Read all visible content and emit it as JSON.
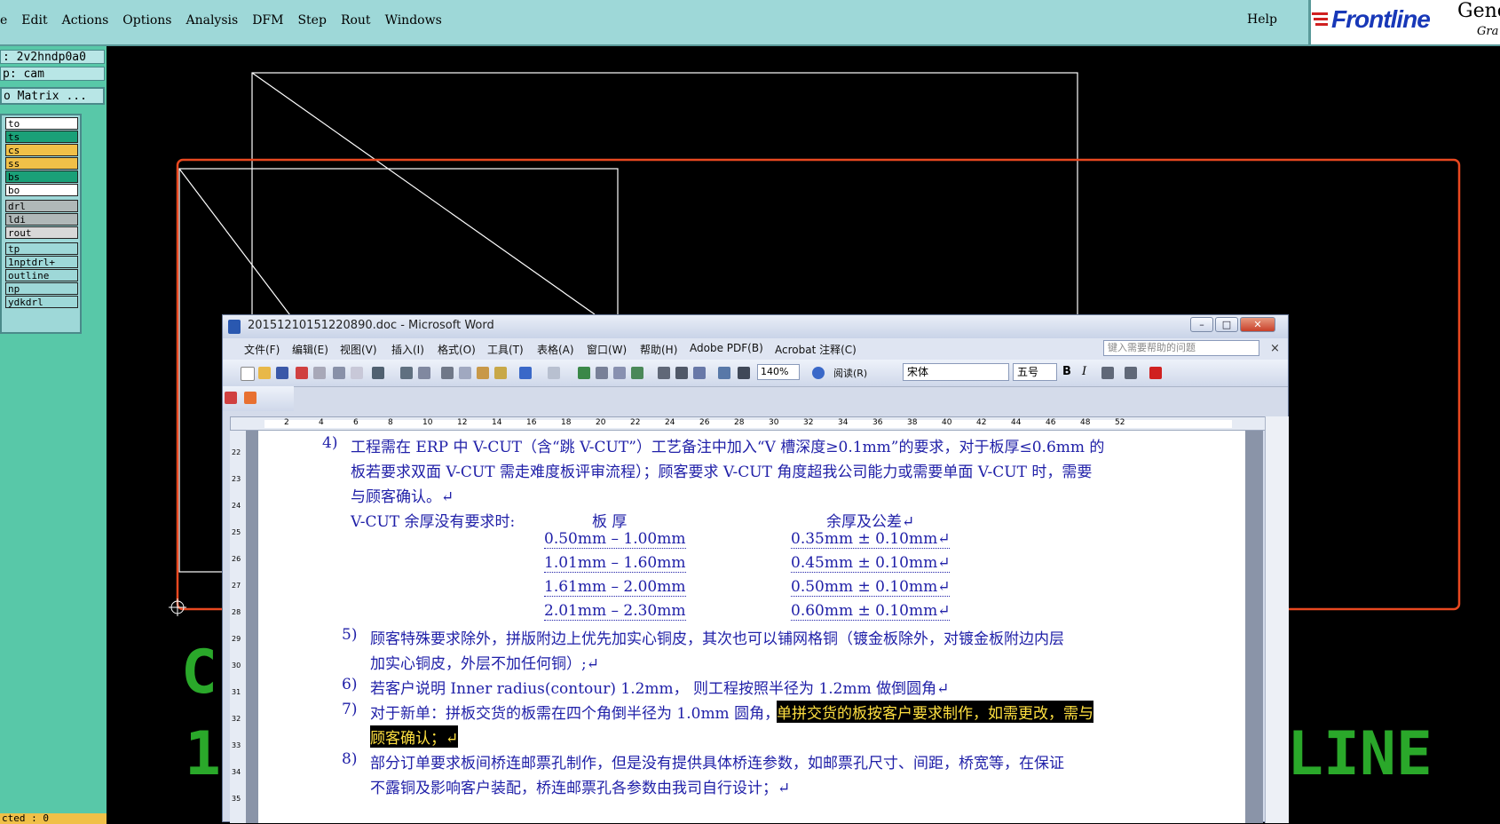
{
  "genesis": {
    "menus": [
      {
        "label": "e"
      },
      {
        "label": "Edit"
      },
      {
        "label": "Actions"
      },
      {
        "label": "Options"
      },
      {
        "label": "Analysis"
      },
      {
        "label": "DFM"
      },
      {
        "label": "Step"
      },
      {
        "label": "Rout"
      },
      {
        "label": "Windows"
      }
    ],
    "help_label": "Help",
    "logo_text": "Frontline",
    "logo_gene": "Gene",
    "logo_gra": "Gra",
    "job_field": ": 2v2hndp0a0",
    "step_field": "p: cam",
    "matrix_button": "o Matrix ...",
    "layers": [
      {
        "name": "to",
        "color": "#ffffff"
      },
      {
        "name": "ts",
        "color": "#1aa078"
      },
      {
        "name": "cs",
        "color": "#f0c048"
      },
      {
        "name": "ss",
        "color": "#f0c048"
      },
      {
        "name": "bs",
        "color": "#1aa078"
      },
      {
        "name": "bo",
        "color": "#ffffff"
      },
      {
        "name": "drl",
        "color": "#b0b8b8"
      },
      {
        "name": "ldi",
        "color": "#b0b8b8"
      },
      {
        "name": "rout",
        "color": "#d8d8d8"
      },
      {
        "name": "tp",
        "color": "#9ed8d8"
      },
      {
        "name": "1nptdrl+",
        "color": "#9ed8d8"
      },
      {
        "name": "outline",
        "color": "#9ed8d8"
      },
      {
        "name": "np",
        "color": "#9ed8d8"
      },
      {
        "name": "ydkdrl",
        "color": "#9ed8d8"
      }
    ],
    "bottom_field": "cted : 0",
    "canvas_text_1": "C",
    "canvas_text_2": "1",
    "canvas_text_3": "LINE"
  },
  "word": {
    "title": "20151210151220890.doc - Microsoft Word",
    "minimize": "–",
    "maximize": "□",
    "close": "✕",
    "menus": [
      {
        "label": "文件(F)"
      },
      {
        "label": "编辑(E)"
      },
      {
        "label": "视图(V)"
      },
      {
        "label": "插入(I)"
      },
      {
        "label": "格式(O)"
      },
      {
        "label": "工具(T)"
      },
      {
        "label": "表格(A)"
      },
      {
        "label": "窗口(W)"
      },
      {
        "label": "帮助(H)"
      },
      {
        "label": "Adobe PDF(B)"
      },
      {
        "label": "Acrobat 注释(C)"
      }
    ],
    "help_placeholder": "键入需要帮助的问题",
    "menu_close": "×",
    "zoom": "140%",
    "read_label": "阅读(R)",
    "font_name": "宋体",
    "font_size": "五号",
    "bold": "B",
    "italic": "I",
    "ruler_numbers": [
      "2",
      "4",
      "6",
      "8",
      "10",
      "12",
      "14",
      "16",
      "18",
      "20",
      "22",
      "24",
      "26",
      "28",
      "30",
      "32",
      "34",
      "36",
      "38",
      "40",
      "42",
      "44",
      "46",
      "48",
      "52"
    ],
    "vruler_numbers": [
      "22",
      "23",
      "24",
      "25",
      "26",
      "27",
      "28",
      "29",
      "30",
      "31",
      "32",
      "33",
      "34",
      "35"
    ],
    "doc": {
      "item4_num": "4)",
      "item4_line1": "工程需在 ERP 中 V-CUT（含“跳 V-CUT”）工艺备注中加入“V 槽深度≥0.1mm”的要求，对于板厚≤0.6mm 的",
      "item4_line2": "板若要求双面 V-CUT 需走难度板评审流程）；顾客要求 V-CUT 角度超我公司能力或需要单面 V-CUT 时，需要",
      "item4_line3": "与顾客确认。↵",
      "vcut_label": "V-CUT 余厚没有要求时:",
      "col_thickness": "板   厚",
      "col_remain": "余厚及公差↵",
      "table_rows": [
        {
          "thickness": "0.50mm – 1.00mm",
          "remain": "0.35mm ± 0.10mm↵"
        },
        {
          "thickness": "1.01mm – 1.60mm",
          "remain": "0.45mm ± 0.10mm↵"
        },
        {
          "thickness": "1.61mm – 2.00mm",
          "remain": "0.50mm ± 0.10mm↵"
        },
        {
          "thickness": "2.01mm – 2.30mm",
          "remain": "0.60mm ± 0.10mm↵"
        }
      ],
      "item5_num": "5)",
      "item5_line1": "顾客特殊要求除外，拼版附边上优先加实心铜皮，其次也可以铺网格铜（镀金板除外，对镀金板附边内层",
      "item5_line2": "加实心铜皮，外层不加任何铜）;↵",
      "item6_num": "6)",
      "item6_line1": "若客户说明 Inner radius(contour) 1.2mm， 则工程按照半径为 1.2mm 做倒圆角↵",
      "item7_num": "7)",
      "item7_line1a": "对于新单：拼板交货的板需在四个角倒半径为 1.0mm 圆角，",
      "item7_line1b": "单拼交货的板按客户要求制作，如需更改，需与",
      "item7_line2": "顾客确认；↵",
      "item8_num": "8)",
      "item8_line1": "部分订单要求板间桥连邮票孔制作，但是没有提供具体桥连参数，如邮票孔尺寸、间距，桥宽等，在保证",
      "item8_line2": "不露铜及影响客户装配，桥连邮票孔各参数由我司自行设计；↵"
    }
  }
}
